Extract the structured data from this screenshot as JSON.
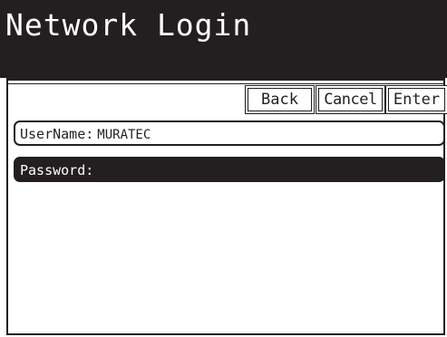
{
  "header": {
    "title": "Network Login"
  },
  "toolbar": {
    "back_label": "Back",
    "cancel_label": "Cancel",
    "enter_label": "Enter"
  },
  "form": {
    "username": {
      "label": "UserName:",
      "value": "MURATEC",
      "selected": false
    },
    "password": {
      "label": "Password:",
      "value": "",
      "selected": true
    }
  },
  "colors": {
    "dark": "#231f20",
    "light": "#ffffff"
  }
}
